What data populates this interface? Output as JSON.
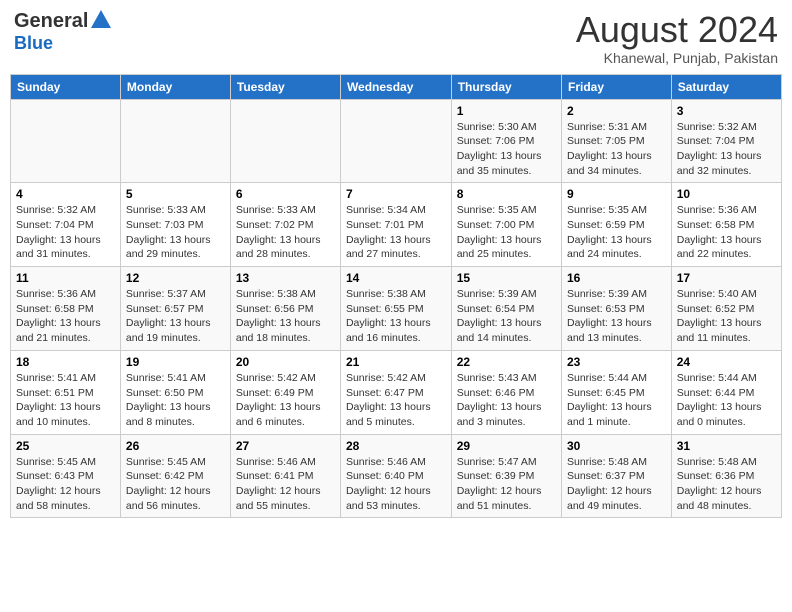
{
  "header": {
    "logo_line1": "General",
    "logo_line2": "Blue",
    "month": "August 2024",
    "location": "Khanewal, Punjab, Pakistan"
  },
  "days_of_week": [
    "Sunday",
    "Monday",
    "Tuesday",
    "Wednesday",
    "Thursday",
    "Friday",
    "Saturday"
  ],
  "weeks": [
    [
      {
        "day": "",
        "info": ""
      },
      {
        "day": "",
        "info": ""
      },
      {
        "day": "",
        "info": ""
      },
      {
        "day": "",
        "info": ""
      },
      {
        "day": "1",
        "info": "Sunrise: 5:30 AM\nSunset: 7:06 PM\nDaylight: 13 hours\nand 35 minutes."
      },
      {
        "day": "2",
        "info": "Sunrise: 5:31 AM\nSunset: 7:05 PM\nDaylight: 13 hours\nand 34 minutes."
      },
      {
        "day": "3",
        "info": "Sunrise: 5:32 AM\nSunset: 7:04 PM\nDaylight: 13 hours\nand 32 minutes."
      }
    ],
    [
      {
        "day": "4",
        "info": "Sunrise: 5:32 AM\nSunset: 7:04 PM\nDaylight: 13 hours\nand 31 minutes."
      },
      {
        "day": "5",
        "info": "Sunrise: 5:33 AM\nSunset: 7:03 PM\nDaylight: 13 hours\nand 29 minutes."
      },
      {
        "day": "6",
        "info": "Sunrise: 5:33 AM\nSunset: 7:02 PM\nDaylight: 13 hours\nand 28 minutes."
      },
      {
        "day": "7",
        "info": "Sunrise: 5:34 AM\nSunset: 7:01 PM\nDaylight: 13 hours\nand 27 minutes."
      },
      {
        "day": "8",
        "info": "Sunrise: 5:35 AM\nSunset: 7:00 PM\nDaylight: 13 hours\nand 25 minutes."
      },
      {
        "day": "9",
        "info": "Sunrise: 5:35 AM\nSunset: 6:59 PM\nDaylight: 13 hours\nand 24 minutes."
      },
      {
        "day": "10",
        "info": "Sunrise: 5:36 AM\nSunset: 6:58 PM\nDaylight: 13 hours\nand 22 minutes."
      }
    ],
    [
      {
        "day": "11",
        "info": "Sunrise: 5:36 AM\nSunset: 6:58 PM\nDaylight: 13 hours\nand 21 minutes."
      },
      {
        "day": "12",
        "info": "Sunrise: 5:37 AM\nSunset: 6:57 PM\nDaylight: 13 hours\nand 19 minutes."
      },
      {
        "day": "13",
        "info": "Sunrise: 5:38 AM\nSunset: 6:56 PM\nDaylight: 13 hours\nand 18 minutes."
      },
      {
        "day": "14",
        "info": "Sunrise: 5:38 AM\nSunset: 6:55 PM\nDaylight: 13 hours\nand 16 minutes."
      },
      {
        "day": "15",
        "info": "Sunrise: 5:39 AM\nSunset: 6:54 PM\nDaylight: 13 hours\nand 14 minutes."
      },
      {
        "day": "16",
        "info": "Sunrise: 5:39 AM\nSunset: 6:53 PM\nDaylight: 13 hours\nand 13 minutes."
      },
      {
        "day": "17",
        "info": "Sunrise: 5:40 AM\nSunset: 6:52 PM\nDaylight: 13 hours\nand 11 minutes."
      }
    ],
    [
      {
        "day": "18",
        "info": "Sunrise: 5:41 AM\nSunset: 6:51 PM\nDaylight: 13 hours\nand 10 minutes."
      },
      {
        "day": "19",
        "info": "Sunrise: 5:41 AM\nSunset: 6:50 PM\nDaylight: 13 hours\nand 8 minutes."
      },
      {
        "day": "20",
        "info": "Sunrise: 5:42 AM\nSunset: 6:49 PM\nDaylight: 13 hours\nand 6 minutes."
      },
      {
        "day": "21",
        "info": "Sunrise: 5:42 AM\nSunset: 6:47 PM\nDaylight: 13 hours\nand 5 minutes."
      },
      {
        "day": "22",
        "info": "Sunrise: 5:43 AM\nSunset: 6:46 PM\nDaylight: 13 hours\nand 3 minutes."
      },
      {
        "day": "23",
        "info": "Sunrise: 5:44 AM\nSunset: 6:45 PM\nDaylight: 13 hours\nand 1 minute."
      },
      {
        "day": "24",
        "info": "Sunrise: 5:44 AM\nSunset: 6:44 PM\nDaylight: 13 hours\nand 0 minutes."
      }
    ],
    [
      {
        "day": "25",
        "info": "Sunrise: 5:45 AM\nSunset: 6:43 PM\nDaylight: 12 hours\nand 58 minutes."
      },
      {
        "day": "26",
        "info": "Sunrise: 5:45 AM\nSunset: 6:42 PM\nDaylight: 12 hours\nand 56 minutes."
      },
      {
        "day": "27",
        "info": "Sunrise: 5:46 AM\nSunset: 6:41 PM\nDaylight: 12 hours\nand 55 minutes."
      },
      {
        "day": "28",
        "info": "Sunrise: 5:46 AM\nSunset: 6:40 PM\nDaylight: 12 hours\nand 53 minutes."
      },
      {
        "day": "29",
        "info": "Sunrise: 5:47 AM\nSunset: 6:39 PM\nDaylight: 12 hours\nand 51 minutes."
      },
      {
        "day": "30",
        "info": "Sunrise: 5:48 AM\nSunset: 6:37 PM\nDaylight: 12 hours\nand 49 minutes."
      },
      {
        "day": "31",
        "info": "Sunrise: 5:48 AM\nSunset: 6:36 PM\nDaylight: 12 hours\nand 48 minutes."
      }
    ]
  ]
}
